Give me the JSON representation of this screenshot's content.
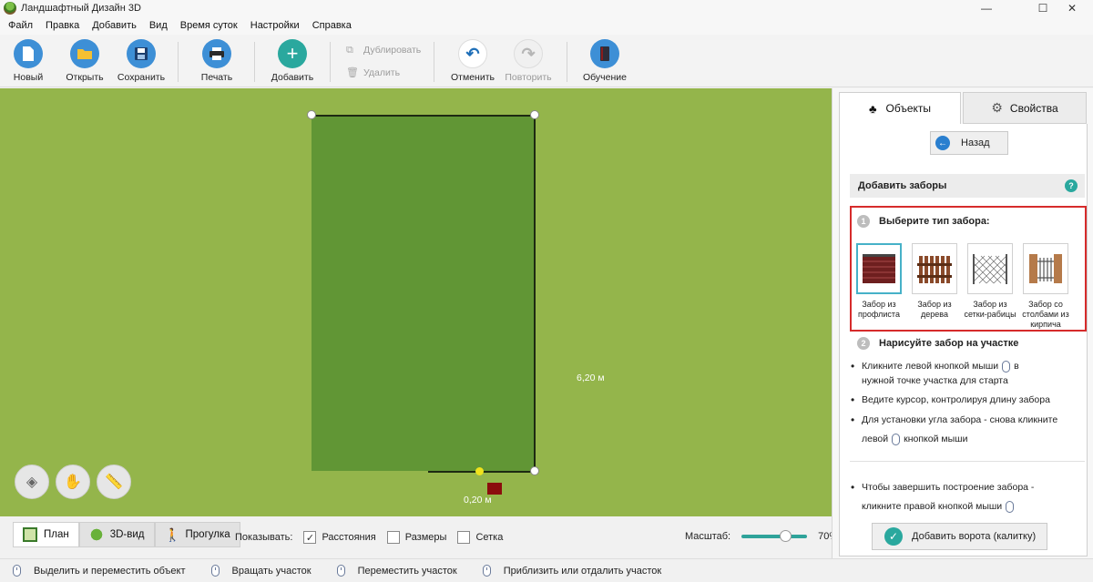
{
  "window": {
    "title": "Ландшафтный Дизайн 3D",
    "minimize": "—",
    "maximize": "☐",
    "close": "✕"
  },
  "menu": [
    "Файл",
    "Правка",
    "Добавить",
    "Вид",
    "Время суток",
    "Настройки",
    "Справка"
  ],
  "toolbar": {
    "new": "Новый",
    "open": "Открыть",
    "save": "Сохранить",
    "print": "Печать",
    "add": "Добавить",
    "duplicate": "Дублировать",
    "delete": "Удалить",
    "undo": "Отменить",
    "redo": "Повторить",
    "tutorial": "Обучение"
  },
  "canvas": {
    "dim_side": "6,20 м",
    "dim_bottom": "0,20 м"
  },
  "view_tabs": [
    "План",
    "3D-вид",
    "Прогулка"
  ],
  "show": {
    "label": "Показывать:",
    "options": [
      {
        "label": "Расстояния",
        "checked": true
      },
      {
        "label": "Размеры",
        "checked": false
      },
      {
        "label": "Сетка",
        "checked": false
      }
    ]
  },
  "zoom": {
    "label": "Масштаб:",
    "value": "70%",
    "level": 0.7
  },
  "status_hints": [
    "Выделить и переместить объект",
    "Вращать участок",
    "Переместить участок",
    "Приблизить или отдалить участок"
  ],
  "panel": {
    "tab_objects": "Объекты",
    "tab_properties": "Свойства",
    "back": "Назад",
    "section_title": "Добавить заборы",
    "help": "?",
    "step1": {
      "num": "1",
      "title": "Выберите тип забора:"
    },
    "fences": [
      {
        "label": "Забор из профлиста",
        "selected": true
      },
      {
        "label": "Забор из дерева",
        "selected": false
      },
      {
        "label": "Забор из сетки-рабицы",
        "selected": false
      },
      {
        "label": "Забор со столбами из кирпича",
        "selected": false
      }
    ],
    "step2": {
      "num": "2",
      "title": "Нарисуйте забор на участке"
    },
    "bullets": {
      "b1_a": "Кликните левой кнопкой мыши",
      "b1_b": "в",
      "b1_c": "нужной точке участка для старта",
      "b2": "Ведите курсор, контролируя длину забора",
      "b3_a": "Для установки угла забора - снова кликните",
      "b3_b": "левой",
      "b3_c": "кнопкой мыши",
      "b4_a": "Чтобы завершить построение забора -",
      "b4_b": "кликните правой кнопкой мыши"
    },
    "gate_button": "Добавить ворота (калитку)"
  },
  "colors": {
    "grass": "#94b54b",
    "plot": "#619635",
    "accent": "#2aa89e",
    "highlight": "#d62b2b"
  }
}
